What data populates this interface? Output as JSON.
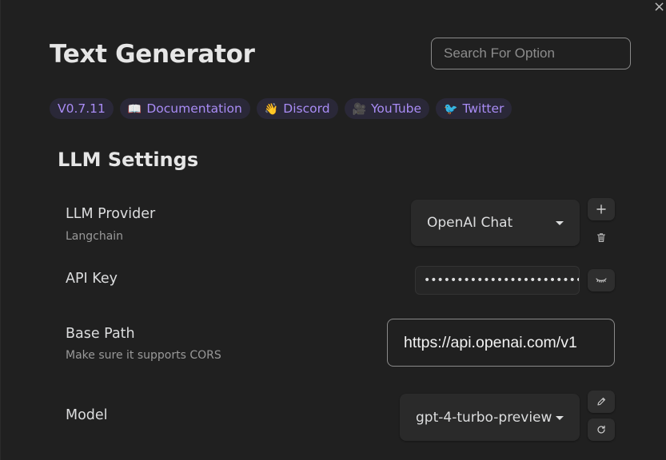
{
  "header": {
    "title": "Text Generator",
    "close_glyph": "×"
  },
  "search": {
    "placeholder": "Search For Option",
    "value": ""
  },
  "badges": [
    {
      "emoji": "",
      "label": "V0.7.11"
    },
    {
      "emoji": "📖",
      "label": "Documentation"
    },
    {
      "emoji": "👋",
      "label": "Discord"
    },
    {
      "emoji": "🎥",
      "label": "YouTube"
    },
    {
      "emoji": "🐦",
      "label": "Twitter"
    }
  ],
  "section": {
    "title": "LLM Settings"
  },
  "settings": {
    "provider": {
      "label": "LLM Provider",
      "description": "Langchain",
      "selected": "OpenAI Chat",
      "add_icon": "plus-icon",
      "delete_icon": "trash-icon"
    },
    "api_key": {
      "label": "API Key",
      "masked_value": "••••••••••••••••••••••••••••••",
      "toggle_icon": "eye-closed-icon"
    },
    "base_path": {
      "label": "Base Path",
      "description": "Make sure it supports CORS",
      "value": "https://api.openai.com/v1"
    },
    "model": {
      "label": "Model",
      "selected": "gpt-4-turbo-preview",
      "edit_icon": "pencil-icon",
      "refresh_icon": "refresh-icon"
    }
  },
  "colors": {
    "background": "#202020",
    "accent": "#a98cf5",
    "badge_bg": "#2a2838",
    "control_bg": "#2a2a2a"
  }
}
